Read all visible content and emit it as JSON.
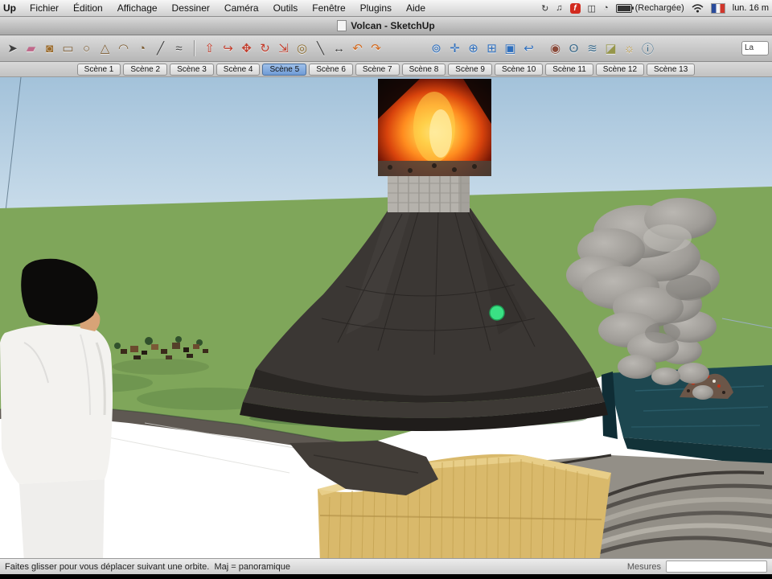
{
  "theme": {
    "tab-selected": "#6f9bd6",
    "grass": "#7fa65a",
    "grass-dark": "#4b7140",
    "volcano": "#3b3734",
    "sand": "#d9b96b",
    "water": "#1d4750",
    "rock-gray": "#938f87",
    "dot-green": "#3ae184",
    "sky-top": "#a3c2da",
    "sky-bottom": "#d9e7f1",
    "lava-orange": "#ff8c1f"
  },
  "menu_bar": {
    "app_partial": "Up",
    "items": [
      "Fichier",
      "Édition",
      "Affichage",
      "Dessiner",
      "Caméra",
      "Outils",
      "Fenêtre",
      "Plugins",
      "Aide"
    ],
    "extras": [
      {
        "name": "sync",
        "glyph": "↻"
      },
      {
        "name": "music",
        "glyph": "♫"
      },
      {
        "name": "facetime",
        "glyph": "f"
      },
      {
        "name": "display",
        "glyph": "◫"
      },
      {
        "name": "time-machine",
        "glyph": "◔"
      }
    ],
    "battery_label": "(Rechargée)",
    "clock": "lun. 16 m"
  },
  "window": {
    "title": "Volcan - SketchUp"
  },
  "toolbar": {
    "layers_field": "La",
    "icons": [
      {
        "name": "select-tool",
        "glyph": "➤",
        "color": "#3f3f3f"
      },
      {
        "name": "eraser-tool",
        "glyph": "▰",
        "color": "#c0688a"
      },
      {
        "name": "paint-bucket-tool",
        "glyph": "◙",
        "color": "#9a6a2a"
      },
      {
        "name": "rectangle-tool",
        "glyph": "▭",
        "color": "#7a5a30"
      },
      {
        "name": "circle-tool",
        "glyph": "○",
        "color": "#7a5a30"
      },
      {
        "name": "polygon-tool",
        "glyph": "△",
        "color": "#7a5a30"
      },
      {
        "name": "arc-tool",
        "glyph": "◠",
        "color": "#7a5a30"
      },
      {
        "name": "pie-tool",
        "glyph": "◔",
        "color": "#7a5a30"
      },
      {
        "name": "line-tool",
        "glyph": "╱",
        "color": "#3f3f3f"
      },
      {
        "name": "freehand-tool",
        "glyph": "≈",
        "color": "#3f3f3f"
      },
      {
        "name": "push-pull-tool",
        "glyph": "⇧",
        "color": "#c23b2a"
      },
      {
        "name": "follow-me-tool",
        "glyph": "↪",
        "color": "#c23b2a"
      },
      {
        "name": "move-tool",
        "glyph": "✥",
        "color": "#c23b2a"
      },
      {
        "name": "rotate-tool",
        "glyph": "↻",
        "color": "#c23b2a"
      },
      {
        "name": "scale-tool",
        "glyph": "⇲",
        "color": "#c23b2a"
      },
      {
        "name": "offset-tool",
        "glyph": "◎",
        "color": "#8a6a2a"
      },
      {
        "name": "tape-measure-tool",
        "glyph": "╲",
        "color": "#3f3f3f"
      },
      {
        "name": "dimension-tool",
        "glyph": "↔",
        "color": "#3f3f3f"
      },
      {
        "name": "undo",
        "glyph": "↶",
        "color": "#d2691e"
      },
      {
        "name": "redo",
        "glyph": "↷",
        "color": "#d2691e"
      },
      {
        "name": "orbit-tool",
        "glyph": "⊚",
        "color": "#2e6fbe"
      },
      {
        "name": "pan-tool",
        "glyph": "✛",
        "color": "#2e6fbe"
      },
      {
        "name": "zoom-tool",
        "glyph": "⊕",
        "color": "#2e6fbe"
      },
      {
        "name": "zoom-window-tool",
        "glyph": "⊞",
        "color": "#2e6fbe"
      },
      {
        "name": "zoom-extents-tool",
        "glyph": "▣",
        "color": "#2e6fbe"
      },
      {
        "name": "previous-view",
        "glyph": "↩",
        "color": "#2e6fbe"
      },
      {
        "name": "position-camera-tool",
        "glyph": "◉",
        "color": "#8a4a3a"
      },
      {
        "name": "look-around-tool",
        "glyph": "ʘ",
        "color": "#3a6a8a"
      },
      {
        "name": "walk-tool",
        "glyph": "≋",
        "color": "#3a6a8a"
      },
      {
        "name": "section-plane-tool",
        "glyph": "◪",
        "color": "#96964a"
      },
      {
        "name": "shadows",
        "glyph": "☼",
        "color": "#c09a3a"
      },
      {
        "name": "model-info",
        "glyph": "ⓘ",
        "color": "#3a6a8a"
      }
    ]
  },
  "scene_tabs": {
    "tabs": [
      "Scène 1",
      "Scène 2",
      "Scène 3",
      "Scène 4",
      "Scène 5",
      "Scène 6",
      "Scène 7",
      "Scène 8",
      "Scène 9",
      "Scène 10",
      "Scène 11",
      "Scène 12",
      "Scène 13"
    ],
    "selected_index": 4,
    "selected_label": "Scène 5"
  },
  "status_bar": {
    "hint": "Faites glisser pour vous déplacer suivant une orbite.  Maj = panoramique",
    "measures_label": "Mesures",
    "measures_value": ""
  }
}
